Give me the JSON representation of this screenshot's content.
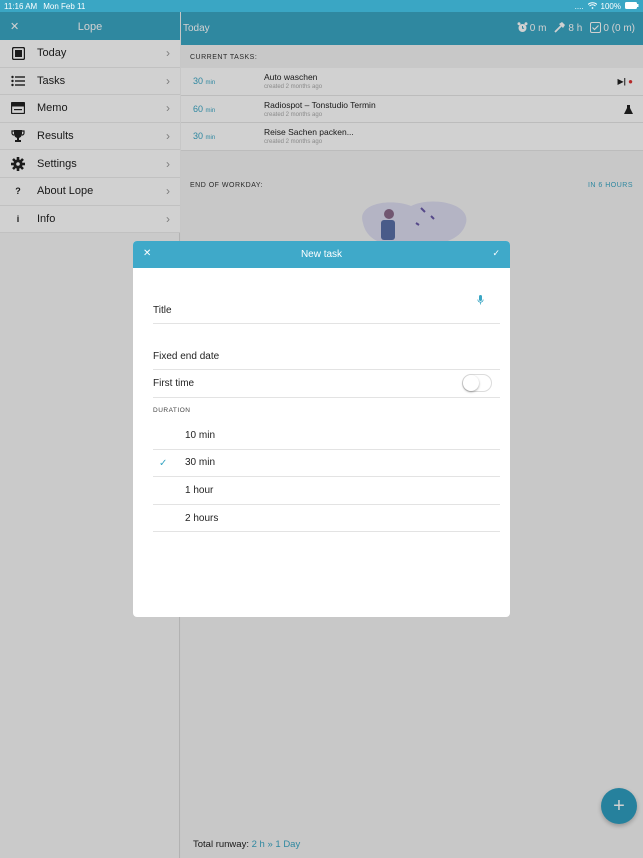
{
  "status": {
    "time": "11:16 AM",
    "date": "Mon Feb 11",
    "dots": "....",
    "battery": "100%"
  },
  "sidebar": {
    "title": "Lope",
    "close_icon": "close-icon",
    "items": [
      {
        "label": "Today",
        "icon": "calendar-icon"
      },
      {
        "label": "Tasks",
        "icon": "list-icon"
      },
      {
        "label": "Memo",
        "icon": "memo-icon"
      },
      {
        "label": "Results",
        "icon": "trophy-icon"
      },
      {
        "label": "Settings",
        "icon": "gear-icon"
      },
      {
        "label": "About Lope",
        "icon": "question-icon"
      },
      {
        "label": "Info",
        "icon": "info-icon"
      }
    ]
  },
  "header": {
    "title": "Today",
    "stat_alarm": "0 m",
    "stat_hammer": "8 h",
    "stat_done": "0 (0 m)"
  },
  "current_tasks_label": "CURRENT TASKS:",
  "tasks": [
    {
      "duration": "30",
      "unit": "min",
      "title": "Auto waschen",
      "sub": "created 2 months ago"
    },
    {
      "duration": "60",
      "unit": "min",
      "title": "Radiospot – Tonstudio Termin",
      "sub": "created 2 months ago"
    },
    {
      "duration": "30",
      "unit": "min",
      "title": "Reise Sachen packen...",
      "sub": "created 2 months ago"
    }
  ],
  "end_of_workday": {
    "label": "END OF WORKDAY:",
    "value": "IN 6 HOURS"
  },
  "runway": {
    "label": "Total runway:",
    "value": "2 h » 1 Day"
  },
  "modal": {
    "title": "New task",
    "title_field_label": "Title",
    "fixed_end_date_label": "Fixed end date",
    "first_time_label": "First time",
    "first_time_on": false,
    "duration_label": "DURATION",
    "options": [
      "10 min",
      "30 min",
      "1 hour",
      "2 hours"
    ],
    "selected_option": "30 min"
  },
  "colors": {
    "accent": "#3aa6c4",
    "header": "#3aa6c4"
  }
}
